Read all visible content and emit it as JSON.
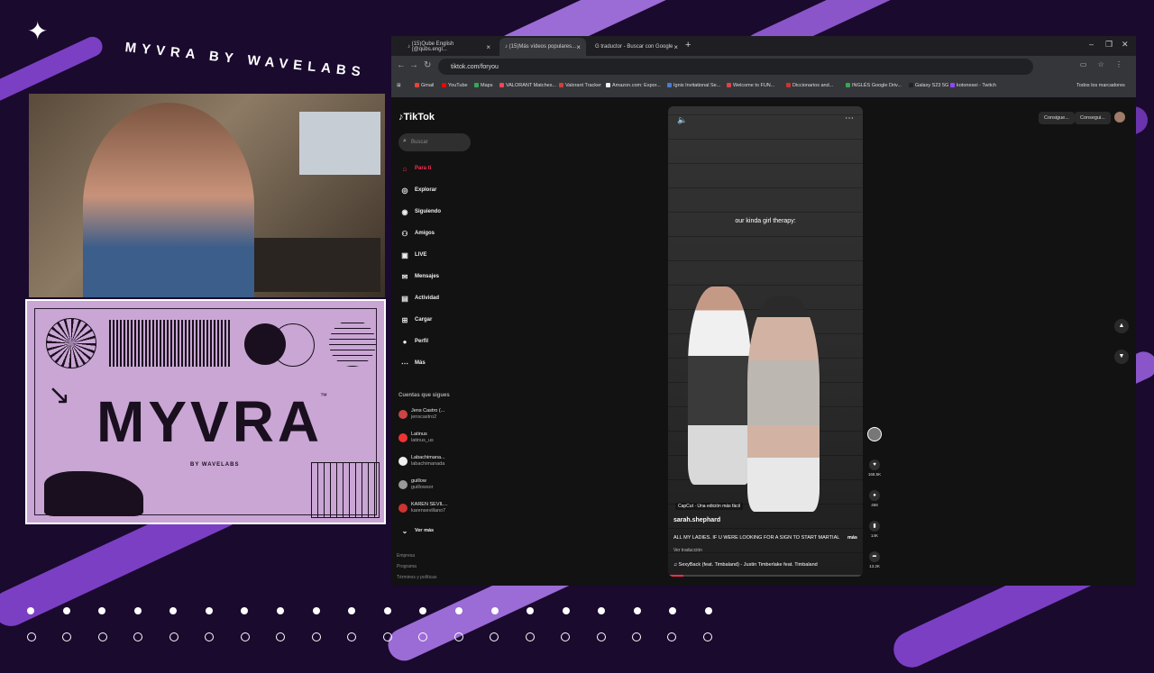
{
  "overlay": {
    "title": "MYVRA BY WAVELABS",
    "brand_word": "MYVRA",
    "brand_tm": "™",
    "brand_sub": "BY WAVELABS",
    "colors": {
      "purple": "#7b3fc4",
      "lilac": "#c9a6d4",
      "dark": "#1a0a2e"
    }
  },
  "browser": {
    "tabs": [
      {
        "label": "(15)Qube English (@qubs.engl...",
        "icon": "tiktok-icon"
      },
      {
        "label": "(15)Más vídeos populares...",
        "icon": "tiktok-icon",
        "active": true
      },
      {
        "label": "traductor - Buscar con Google",
        "icon": "google-icon"
      }
    ],
    "url": "tiktok.com/foryou",
    "bookmarks": [
      {
        "label": "Gmail",
        "color": "#ea4335"
      },
      {
        "label": "YouTube",
        "color": "#ff0000"
      },
      {
        "label": "Maps",
        "color": "#34a853"
      },
      {
        "label": "VALORANT Matches...",
        "color": "#fa4454"
      },
      {
        "label": "Valorant Tracker",
        "color": "#d43d3d"
      },
      {
        "label": "Amazon.com: Espor...",
        "color": "#f2f2f2"
      },
      {
        "label": "Ignis Invitational Se...",
        "color": "#4a7bd4"
      },
      {
        "label": "Welcome to FUN...",
        "color": "#d44"
      },
      {
        "label": "Diccionarios and...",
        "color": "#c33"
      },
      {
        "label": "INGLÉS Google Driv...",
        "color": "#34a853"
      },
      {
        "label": "Galaxy S23 5G",
        "color": "#222"
      },
      {
        "label": "kotonesei - Twitch",
        "color": "#9146ff"
      }
    ],
    "all_bookmarks": "Todos los marcadores"
  },
  "tiktok": {
    "logo": "TikTok",
    "search_placeholder": "Buscar",
    "nav": [
      {
        "label": "Para ti",
        "icon": "home-icon",
        "active": true
      },
      {
        "label": "Explorar",
        "icon": "compass-icon"
      },
      {
        "label": "Siguiendo",
        "icon": "following-icon"
      },
      {
        "label": "Amigos",
        "icon": "friends-icon"
      },
      {
        "label": "LIVE",
        "icon": "live-icon"
      },
      {
        "label": "Mensajes",
        "icon": "messages-icon"
      },
      {
        "label": "Actividad",
        "icon": "activity-icon"
      },
      {
        "label": "Cargar",
        "icon": "upload-icon"
      },
      {
        "label": "Perfil",
        "icon": "profile-icon"
      },
      {
        "label": "Más",
        "icon": "more-icon"
      }
    ],
    "following_title": "Cuentas que sigues",
    "following": [
      {
        "name": "Jens Castro (...",
        "user": "jenscastro2",
        "color": "#c44"
      },
      {
        "name": "Latinus",
        "user": "latinus_us",
        "color": "#e33"
      },
      {
        "name": "Labachimana...",
        "user": "labachimanada",
        "color": "#eee"
      },
      {
        "name": "guillow",
        "user": "guillowsor",
        "color": "#999"
      },
      {
        "name": "KAREN SEVIL...",
        "user": "karensevillano7",
        "color": "#c33"
      }
    ],
    "see_more": "Ver más",
    "footer": [
      "Empresa",
      "Programa",
      "Términos y políticas"
    ],
    "top_buttons": [
      "Consigue...",
      "Consegui..."
    ],
    "video": {
      "caption_overlay": "our kinda girl therapy:",
      "tag": "CapCut · Una edición más fácil",
      "username": "sarah.shephard",
      "description": "ALL MY LADIES. IF U WERE LOOKING FOR A SIGN TO START MARTIAL",
      "more": "más",
      "translation": "Ver traducción",
      "music": "SexyBack (feat. Timbaland) - Justin Timberlake feat. Timbaland",
      "progress": 0.08
    },
    "actions": {
      "likes": "168.5K",
      "comments": "468",
      "saves": "14K",
      "shares": "13.2K"
    }
  }
}
